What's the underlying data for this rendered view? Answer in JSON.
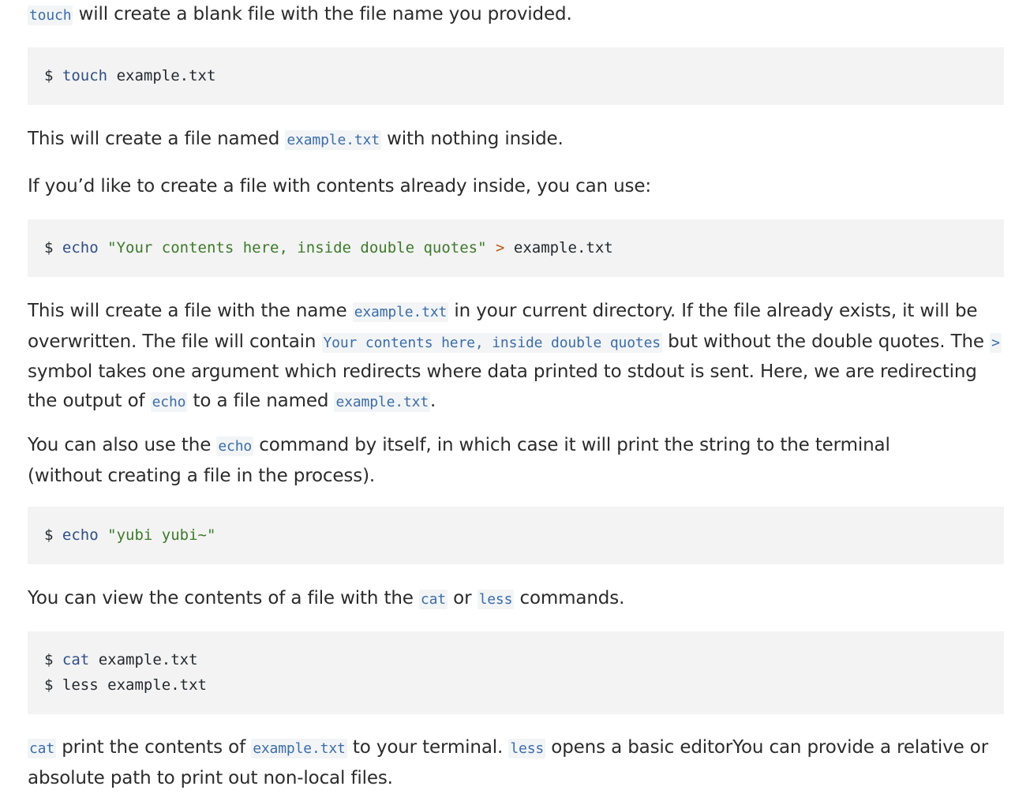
{
  "intro": {
    "code": "touch",
    "text": "will create a blank file with the file name you provided."
  },
  "block_touch": {
    "prompt": "$",
    "cmd": "touch",
    "arg": "example.txt"
  },
  "p_touch_result": {
    "before": "This will create a file named",
    "code": "example.txt",
    "after": "with nothing inside."
  },
  "p_contents_intro": "If you’d like to create a file with contents already inside, you can use:",
  "block_echo_redirect": {
    "prompt": "$",
    "cmd": "echo",
    "str": "\"Your contents here, inside double quotes\"",
    "op": ">",
    "arg": "example.txt"
  },
  "p_redirect_explain": {
    "t1": "This will create a file with the name",
    "c1": "example.txt",
    "t2": "in your current directory. If the file already exists, it will be overwritten. The file will contain",
    "c2": "Your contents here, inside double quotes",
    "t3": "but without the double quotes. The",
    "c3": ">",
    "t4": "symbol takes one argument which redirects where data printed to stdout is sent. Here, we are redirecting the output of",
    "c4": "echo",
    "t5": "to a file named",
    "c5": "example.txt",
    "t6": "."
  },
  "p_echo_alone": {
    "t1": "You can also use the",
    "c1": "echo",
    "t2": "command by itself, in which case it will print the string to the terminal (without creating a file in the process)."
  },
  "block_echo_plain": {
    "prompt": "$",
    "cmd": "echo",
    "str": "\"yubi yubi~\""
  },
  "p_view": {
    "t1": "You can view the contents of a file with the",
    "c1": "cat",
    "t2": "or",
    "c2": "less",
    "t3": "commands."
  },
  "block_view": {
    "line1": {
      "prompt": "$",
      "cmd": "cat",
      "arg": "example.txt"
    },
    "line2": {
      "prompt": "$",
      "cmd": "less",
      "arg": "example.txt"
    }
  },
  "p_final": {
    "c1": "cat",
    "t1": "print the contents of",
    "c2": "example.txt",
    "t2": "to your terminal.",
    "c3": "less",
    "t3": "opens a basic editorYou can provide a relative or absolute path to print out non-local files."
  }
}
